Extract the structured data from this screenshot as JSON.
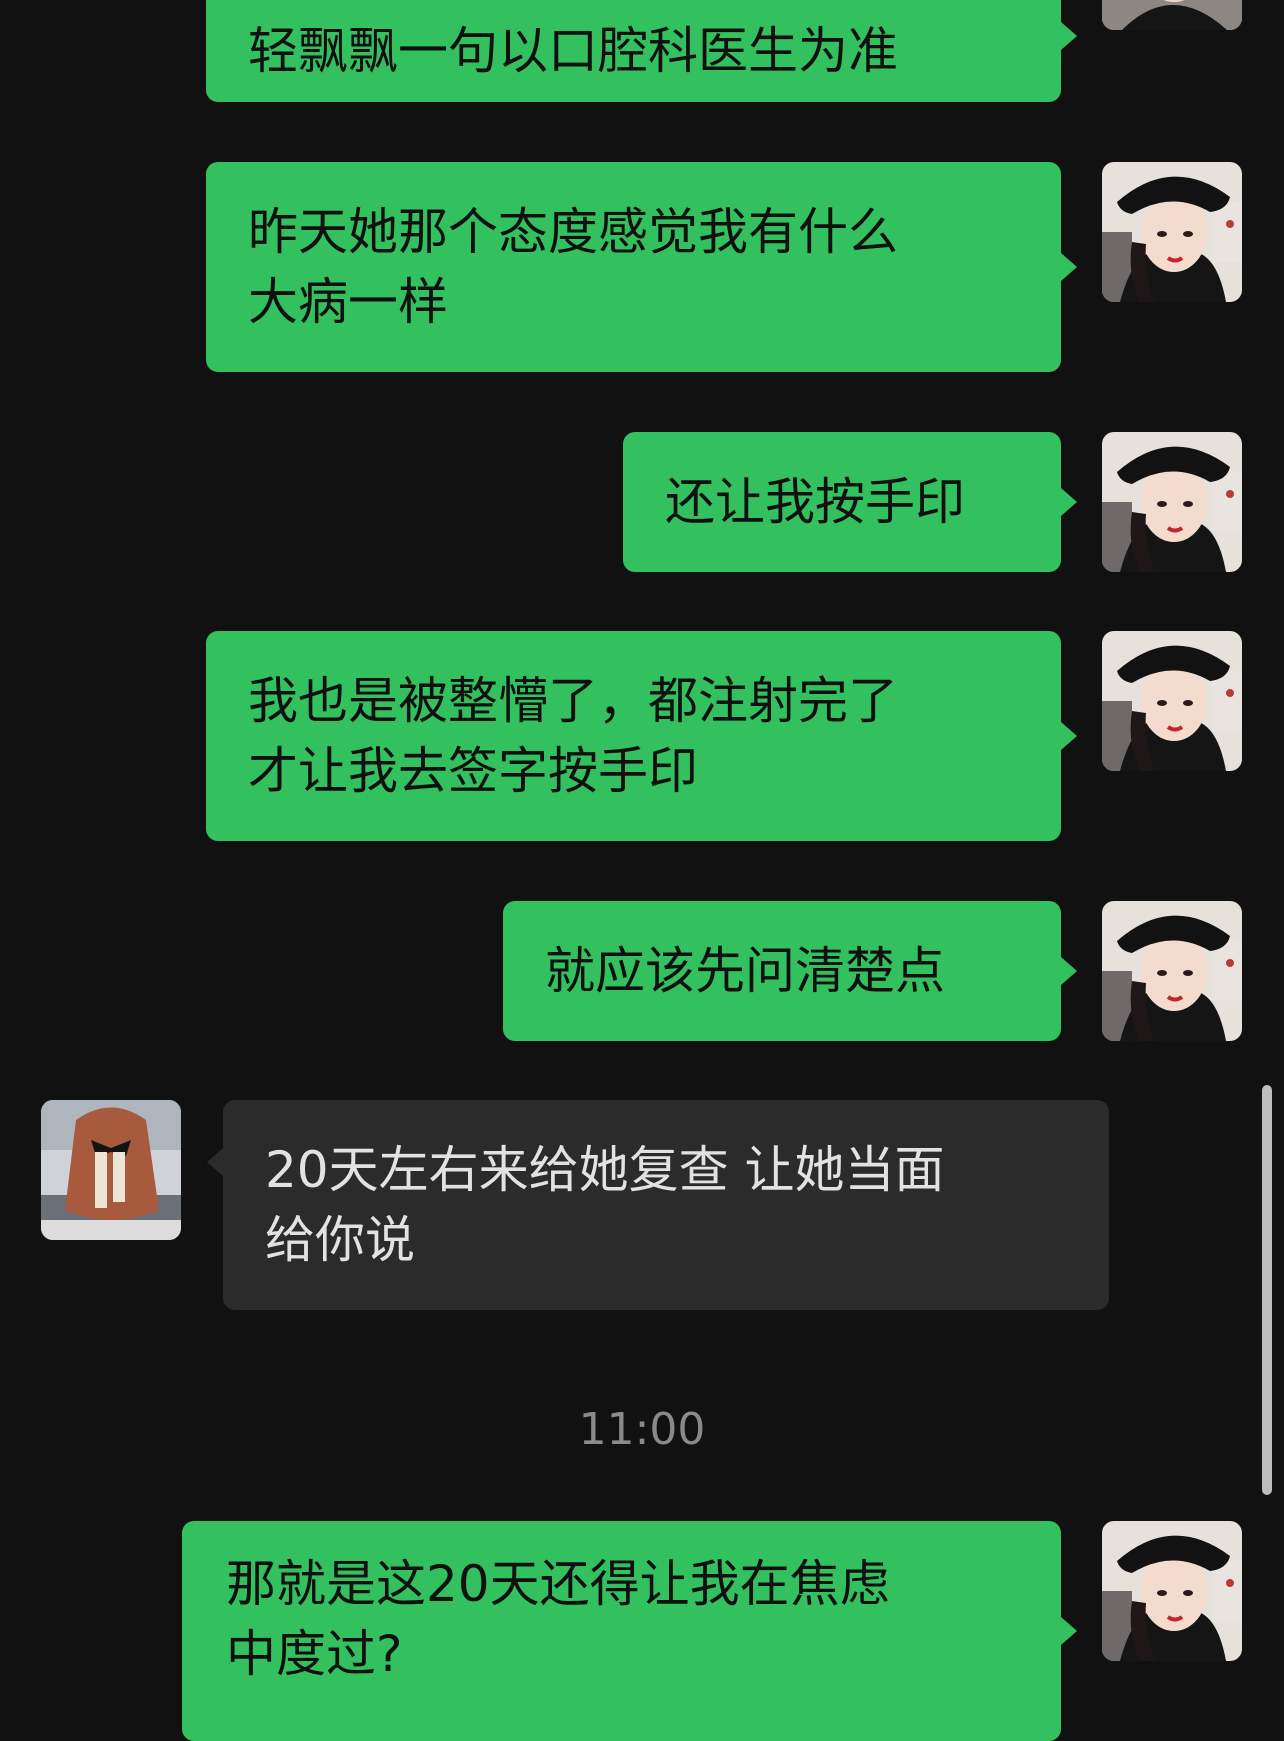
{
  "messages": [
    {
      "side": "out",
      "text": "轻飘飘一句以口腔科医生为准"
    },
    {
      "side": "out",
      "lines": [
        "昨天她那个态度感觉我有什么",
        "大病一样"
      ]
    },
    {
      "side": "out",
      "text": "还让我按手印"
    },
    {
      "side": "out",
      "lines": [
        "我也是被整懵了，都注射完了",
        "才让我去签字按手印"
      ]
    },
    {
      "side": "out",
      "text": "就应该先问清楚点"
    },
    {
      "side": "in",
      "lines": [
        "20天左右来给她复查 让她当面",
        "给你说"
      ]
    },
    {
      "side": "out",
      "lines": [
        "那就是这20天还得让我在焦虑",
        "中度过?"
      ]
    }
  ],
  "timestamp": "11:00",
  "colors": {
    "background": "#111111",
    "outgoing_bubble": "#33c15f",
    "incoming_bubble": "#2b2b2b",
    "timestamp_text": "#8a8a8a"
  },
  "icons": {
    "self_avatar": "avatar-woman-black-hat",
    "contact_avatar": "avatar-girl-hair-bow"
  }
}
